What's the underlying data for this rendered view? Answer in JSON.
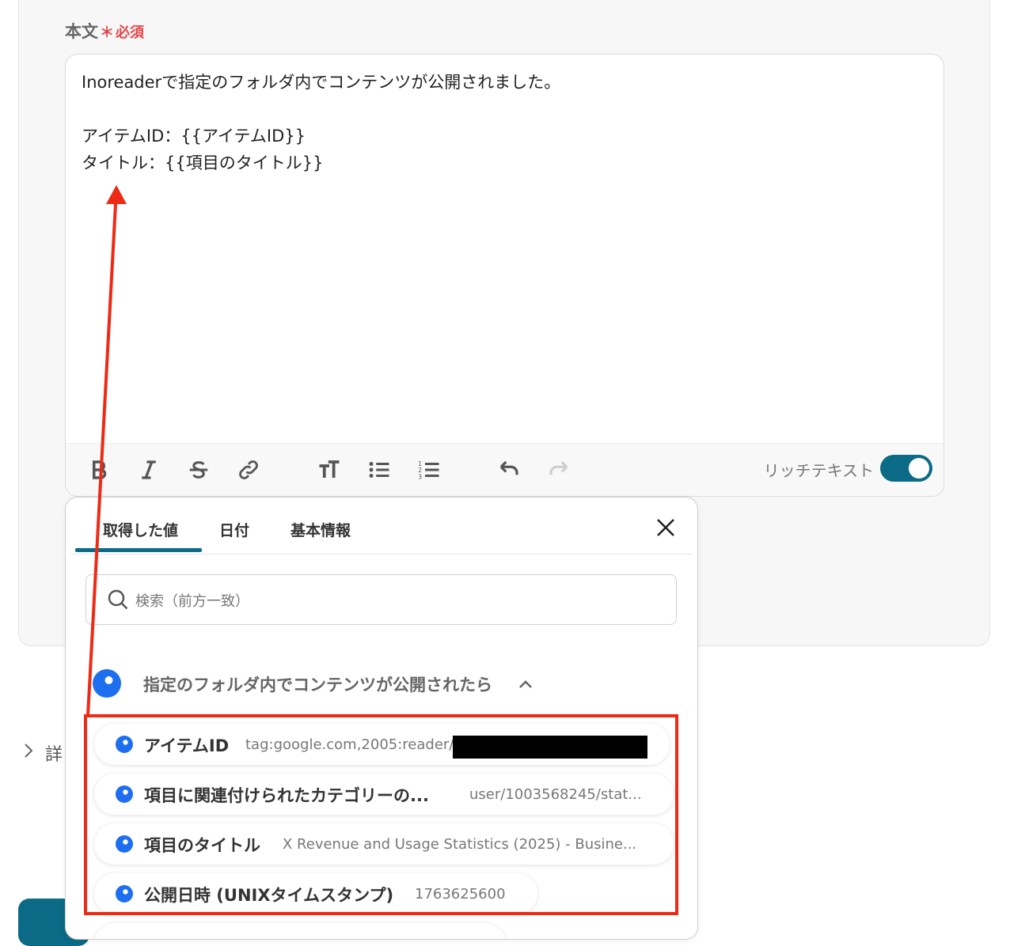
{
  "field": {
    "label": "本文",
    "required_mark": "＊",
    "required_text": "必須"
  },
  "editor": {
    "lines": [
      "Inoreaderで指定のフォルダ内でコンテンツが公開されました。",
      "",
      "アイテムID：{{アイテムID}}",
      "タイトル：{{項目のタイトル}}"
    ],
    "rich_text_label": "リッチテキスト",
    "rich_text_enabled": true
  },
  "toolbar_icons": [
    "bold-icon",
    "italic-icon",
    "strikethrough-icon",
    "link-icon",
    "text-size-icon",
    "bullet-list-icon",
    "numbered-list-icon",
    "undo-icon",
    "redo-icon"
  ],
  "detail_label": "詳",
  "popup": {
    "tabs": [
      {
        "label": "取得した値",
        "active": true
      },
      {
        "label": "日付",
        "active": false
      },
      {
        "label": "基本情報",
        "active": false
      }
    ],
    "search_placeholder": "検索（前方一致）",
    "group_title": "指定のフォルダ内でコンテンツが公開されたら",
    "items": [
      {
        "name": "アイテムID",
        "value": "tag:google.com,2005:reader/",
        "redacted": true
      },
      {
        "name": "項目に関連付けられたカテゴリーの...",
        "value": "user/1003568245/stat..."
      },
      {
        "name": "項目のタイトル",
        "value": "X Revenue and Usage Statistics (2025) - Busine..."
      },
      {
        "name": "公開日時 (UNIXタイムスタンプ)",
        "value": "1763625600"
      }
    ]
  },
  "colors": {
    "accent": "#0b6b86",
    "required": "#e5484d",
    "annotation": "#ee2a15",
    "dot": "#1e6ff0"
  }
}
